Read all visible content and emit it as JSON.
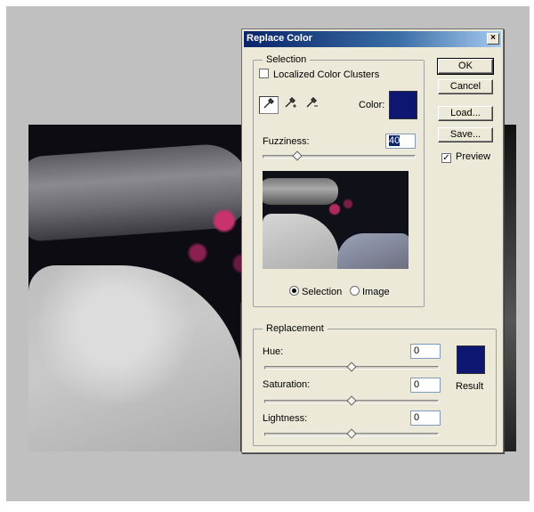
{
  "dialog": {
    "title": "Replace Color",
    "close_glyph": "×"
  },
  "selection": {
    "group_label": "Selection",
    "localized_clusters_label": "Localized Color Clusters",
    "localized_clusters_checked": false,
    "color_label": "Color:",
    "color_value": "#0d1670",
    "eyedropper_icons": [
      "eyedropper-icon",
      "eyedropper-plus-icon",
      "eyedropper-minus-icon"
    ],
    "fuzziness_label": "Fuzziness:",
    "fuzziness_value": "40",
    "fuzziness_fraction": 0.2,
    "view_options": [
      {
        "label": "Selection",
        "selected": true
      },
      {
        "label": "Image",
        "selected": false
      }
    ]
  },
  "buttons": {
    "ok": "OK",
    "cancel": "Cancel",
    "load": "Load...",
    "save": "Save...",
    "preview_label": "Preview",
    "preview_checked": true
  },
  "replacement": {
    "group_label": "Replacement",
    "hue_label": "Hue:",
    "hue_value": "0",
    "saturation_label": "Saturation:",
    "saturation_value": "0",
    "lightness_label": "Lightness:",
    "lightness_value": "0",
    "slider_fraction": 0.5,
    "result_label": "Result",
    "result_color": "#0d1670"
  }
}
